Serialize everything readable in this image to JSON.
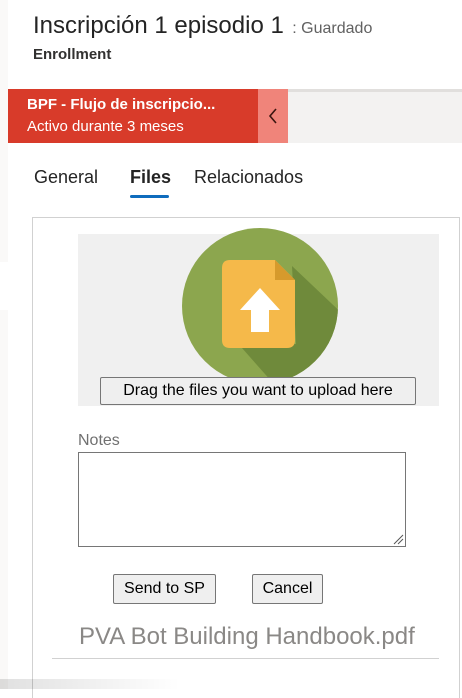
{
  "header": {
    "title": "Inscripción 1 episodio 1",
    "save_status": ": Guardado",
    "entity": "Enrollment"
  },
  "bpf": {
    "name": "BPF - Flujo de inscripcio...",
    "duration": "Activo durante 3 meses",
    "collapse_icon": "chevron-left-icon",
    "color": "#d83b2a"
  },
  "tabs": [
    {
      "label": "General"
    },
    {
      "label": "Files",
      "selected": true
    },
    {
      "label": "Relacionados"
    }
  ],
  "upload": {
    "icon": "file-upload-icon",
    "drag_label": "Drag the files you want to upload here"
  },
  "notes": {
    "label": "Notes",
    "value": ""
  },
  "actions": {
    "send_label": "Send to SP",
    "cancel_label": "Cancel"
  },
  "files": [
    {
      "name": "PVA Bot Building Handbook.pdf"
    }
  ]
}
